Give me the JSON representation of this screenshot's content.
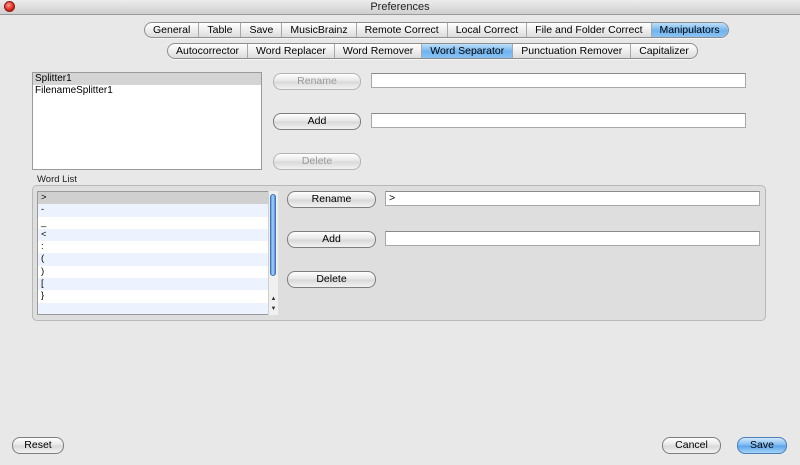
{
  "window": {
    "title": "Preferences"
  },
  "main_tabs": [
    {
      "label": "General",
      "selected": false
    },
    {
      "label": "Table",
      "selected": false
    },
    {
      "label": "Save",
      "selected": false
    },
    {
      "label": "MusicBrainz",
      "selected": false
    },
    {
      "label": "Remote Correct",
      "selected": false
    },
    {
      "label": "Local Correct",
      "selected": false
    },
    {
      "label": "File and Folder Correct",
      "selected": false
    },
    {
      "label": "Manipulators",
      "selected": true
    }
  ],
  "sub_tabs": [
    {
      "label": "Autocorrector",
      "selected": false
    },
    {
      "label": "Word Replacer",
      "selected": false
    },
    {
      "label": "Word Remover",
      "selected": false
    },
    {
      "label": "Word Separator",
      "selected": true
    },
    {
      "label": "Punctuation Remover",
      "selected": false
    },
    {
      "label": "Capitalizer",
      "selected": false
    }
  ],
  "splitters": {
    "items": [
      {
        "label": "Splitter1",
        "selected": true
      },
      {
        "label": "FilenameSplitter1",
        "selected": false
      }
    ],
    "rename_label": "Rename",
    "add_label": "Add",
    "delete_label": "Delete",
    "rename_value": "",
    "add_value": ""
  },
  "word_list": {
    "title": "Word List",
    "items": [
      ">",
      "-",
      "_",
      "<",
      ":",
      "(",
      ")",
      "[",
      "}"
    ],
    "selected_index": 0,
    "rename_label": "Rename",
    "add_label": "Add",
    "delete_label": "Delete",
    "rename_value": ">",
    "add_value": ""
  },
  "footer": {
    "reset_label": "Reset",
    "cancel_label": "Cancel",
    "save_label": "Save"
  }
}
